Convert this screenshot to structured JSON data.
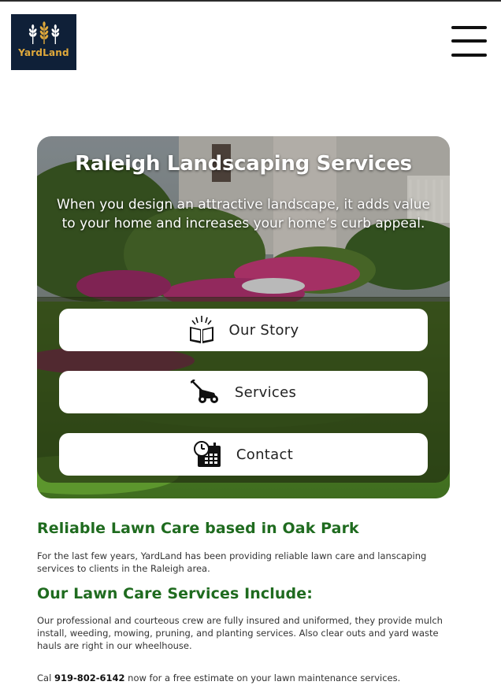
{
  "header": {
    "logo_text": "YardLand",
    "menu_icon": "hamburger-menu-icon",
    "brand_colors": {
      "navy": "#0f2038",
      "gold": "#e0a93b"
    }
  },
  "hero": {
    "title": "Raleigh Landscaping Services",
    "subtitle": "When you design an attractive landscape, it adds value to your home and increases your home’s curb appeal.",
    "buttons": [
      {
        "label": "Our Story",
        "icon": "open-book-icon"
      },
      {
        "label": "Services",
        "icon": "lawn-mower-icon"
      },
      {
        "label": "Contact",
        "icon": "calendar-clock-icon"
      }
    ]
  },
  "content": {
    "section1_heading": "Reliable Lawn Care based in Oak Park",
    "section1_text": "For the last few years, YardLand has been providing reliable lawn care and lanscaping services to clients in the Raleigh area.",
    "section2_heading": "Our Lawn Care Services Include:",
    "section2_text": "Our professional and courteous crew are fully insured and uniformed, they provide mulch install, weeding, mowing, pruning, and planting services. Also clear outs and yard waste hauls are right in our wheelhouse.",
    "cta_prefix": "Cal ",
    "cta_phone": "919-802-6142",
    "cta_suffix": " now for a free estimate on your lawn maintenance services.",
    "heading_color": "#1f6b1f"
  }
}
